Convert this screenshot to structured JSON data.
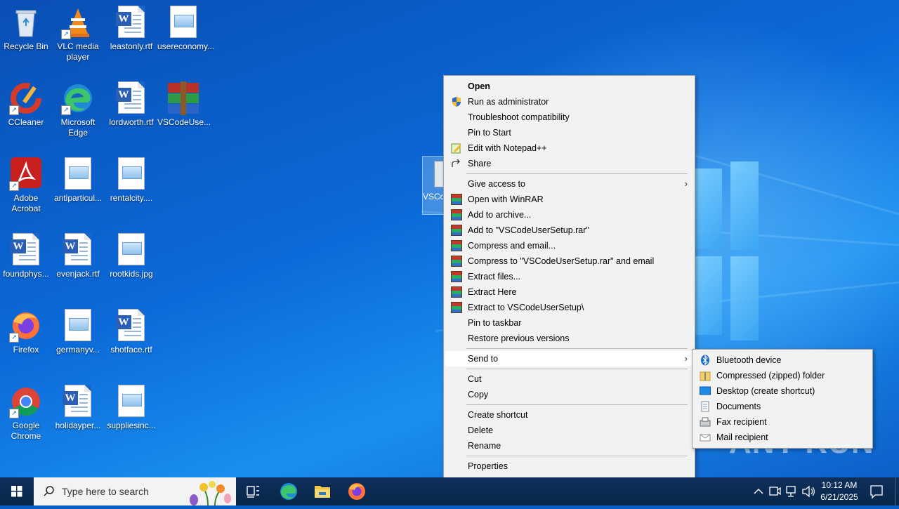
{
  "desktop_icons": [
    {
      "label": "Recycle Bin"
    },
    {
      "label": "VLC media player"
    },
    {
      "label": "leastonly.rtf"
    },
    {
      "label": "usereconomy..."
    },
    {
      "label": "CCleaner"
    },
    {
      "label": "Microsoft Edge"
    },
    {
      "label": "lordworth.rtf"
    },
    {
      "label": "VSCodeUse..."
    },
    {
      "label": "Adobe Acrobat"
    },
    {
      "label": "antiparticul..."
    },
    {
      "label": "rentalcity...."
    },
    {
      "label": "foundphys..."
    },
    {
      "label": "evenjack.rtf"
    },
    {
      "label": "rootkids.jpg"
    },
    {
      "label": "Firefox"
    },
    {
      "label": "germanyv..."
    },
    {
      "label": "shotface.rtf"
    },
    {
      "label": "Google Chrome"
    },
    {
      "label": "holidayper..."
    },
    {
      "label": "suppliesinc..."
    }
  ],
  "selected_file": {
    "label": "VSCodeUserSetup"
  },
  "context_menu": {
    "items": [
      {
        "label": "Open",
        "icon": "none"
      },
      {
        "label": "Run as administrator",
        "icon": "shield-icon"
      },
      {
        "label": "Troubleshoot compatibility",
        "icon": "none"
      },
      {
        "label": "Pin to Start",
        "icon": "none"
      },
      {
        "label": "Edit with Notepad++",
        "icon": "notepadpp-icon"
      },
      {
        "label": "Share",
        "icon": "share-icon"
      },
      {
        "label": "Give access to",
        "icon": "none"
      },
      {
        "label": "Open with WinRAR",
        "icon": "winrar-icon"
      },
      {
        "label": "Add to archive...",
        "icon": "winrar-icon"
      },
      {
        "label": "Add to \"VSCodeUserSetup.rar\"",
        "icon": "winrar-icon"
      },
      {
        "label": "Compress and email...",
        "icon": "winrar-icon"
      },
      {
        "label": "Compress to \"VSCodeUserSetup.rar\" and email",
        "icon": "winrar-icon"
      },
      {
        "label": "Extract files...",
        "icon": "winrar-icon"
      },
      {
        "label": "Extract Here",
        "icon": "winrar-icon"
      },
      {
        "label": "Extract to VSCodeUserSetup\\",
        "icon": "winrar-icon"
      },
      {
        "label": "Pin to taskbar",
        "icon": "none"
      },
      {
        "label": "Restore previous versions",
        "icon": "none"
      },
      {
        "label": "Send to",
        "icon": "none"
      },
      {
        "label": "Cut",
        "icon": "none"
      },
      {
        "label": "Copy",
        "icon": "none"
      },
      {
        "label": "Create shortcut",
        "icon": "none"
      },
      {
        "label": "Delete",
        "icon": "none"
      },
      {
        "label": "Rename",
        "icon": "none"
      },
      {
        "label": "Properties",
        "icon": "none"
      }
    ],
    "submenu_arrow": "›"
  },
  "send_to_menu": {
    "items": [
      {
        "label": "Bluetooth device",
        "icon": "bluetooth-icon"
      },
      {
        "label": "Compressed (zipped) folder",
        "icon": "zip-folder-icon"
      },
      {
        "label": "Desktop (create shortcut)",
        "icon": "desktop-icon"
      },
      {
        "label": "Documents",
        "icon": "documents-icon"
      },
      {
        "label": "Fax recipient",
        "icon": "fax-icon"
      },
      {
        "label": "Mail recipient",
        "icon": "mail-icon"
      }
    ]
  },
  "taskbar": {
    "search_placeholder": "Type here to search",
    "time": "10:12 AM",
    "date": "6/21/2025"
  },
  "watermark": "ANY RUN"
}
